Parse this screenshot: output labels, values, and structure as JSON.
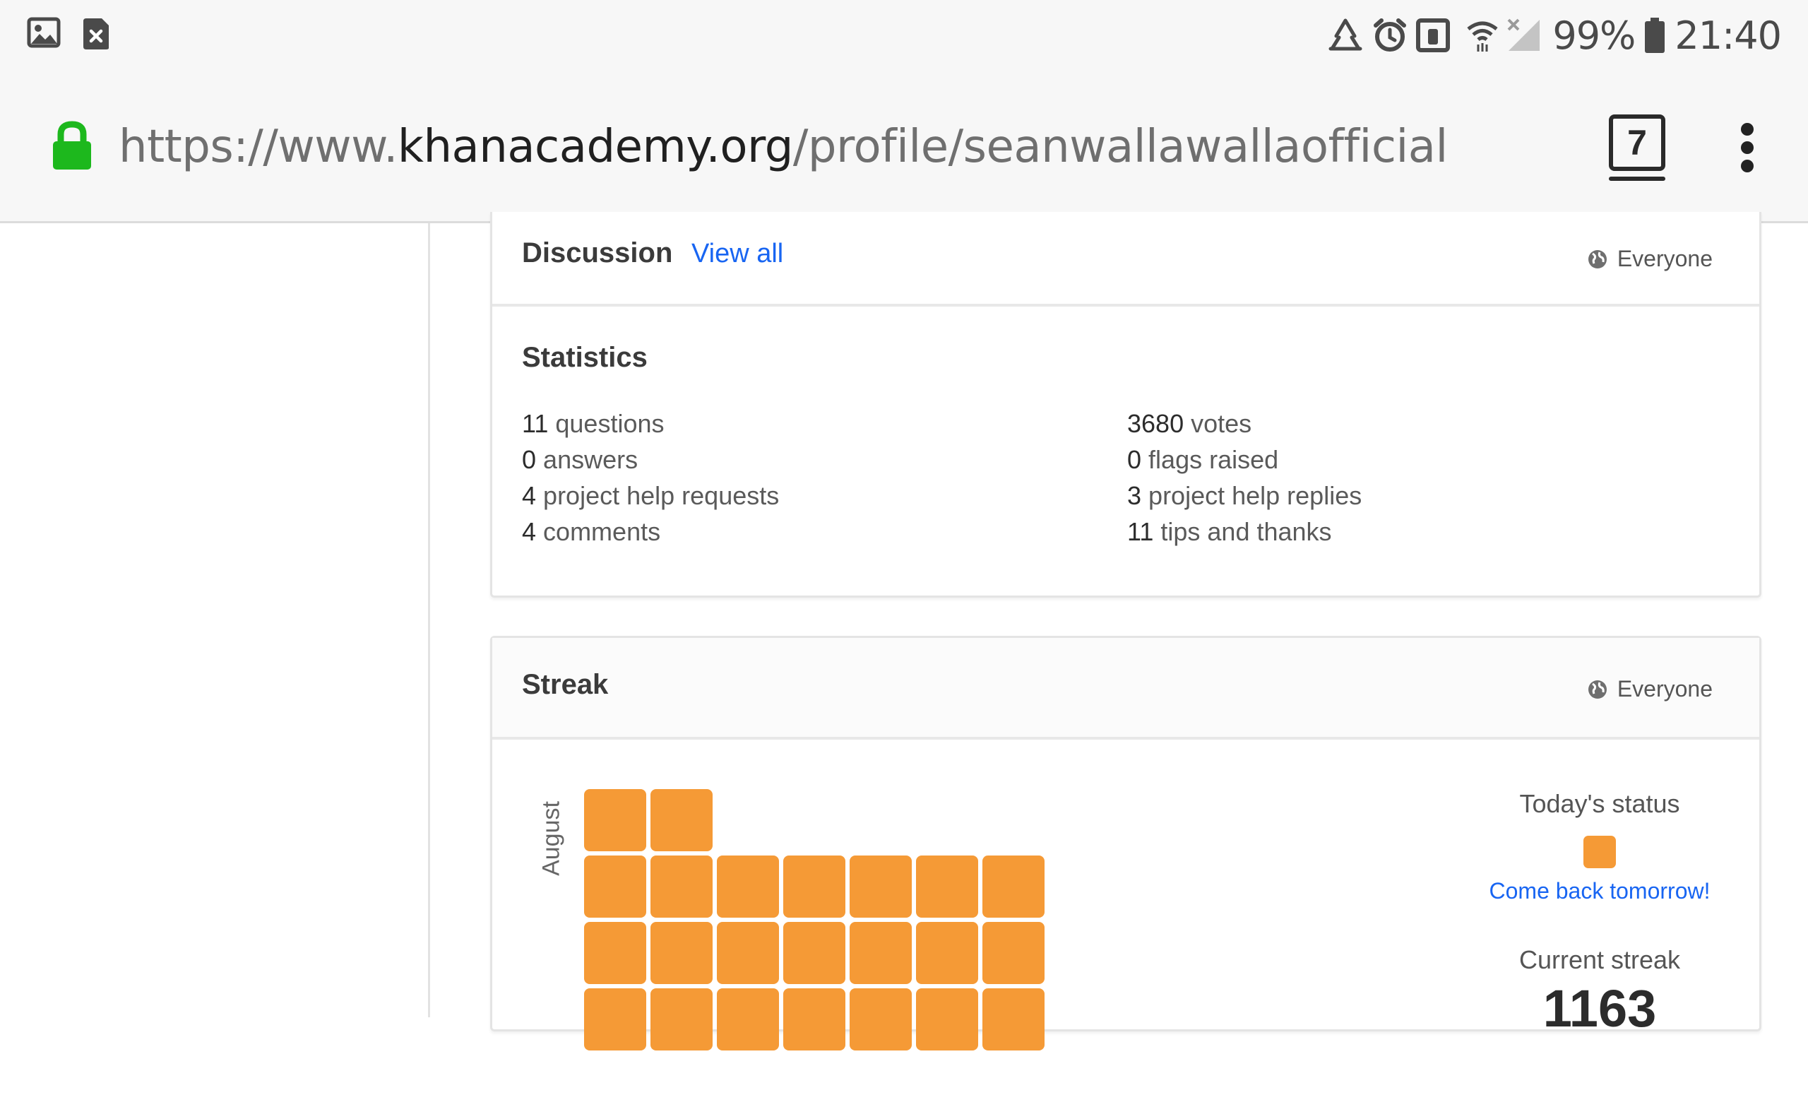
{
  "status_bar": {
    "battery": "99%",
    "time": "21:40"
  },
  "address_bar": {
    "url_prefix": "https://www.",
    "url_host": "khanacademy.org",
    "url_path": "/profile/seanwallawallaofficial",
    "tab_count": "7"
  },
  "discussion": {
    "title": "Discussion",
    "view_all": "View all",
    "privacy": "Everyone"
  },
  "statistics": {
    "title": "Statistics",
    "left": [
      {
        "num": "11",
        "label": "questions"
      },
      {
        "num": "0",
        "label": "answers"
      },
      {
        "num": "4",
        "label": "project help requests"
      },
      {
        "num": "4",
        "label": "comments"
      }
    ],
    "right": [
      {
        "num": "3680",
        "label": "votes"
      },
      {
        "num": "0",
        "label": "flags raised"
      },
      {
        "num": "3",
        "label": "project help replies"
      },
      {
        "num": "11",
        "label": "tips and thanks"
      }
    ]
  },
  "streak": {
    "title": "Streak",
    "privacy": "Everyone",
    "month": "August",
    "todays_status_label": "Today's status",
    "come_back": "Come back tomorrow!",
    "current_streak_label": "Current streak",
    "current_streak_value": "1163",
    "cell_color": "#f59a36"
  },
  "colors": {
    "link": "#1865f2",
    "lock": "#1db81d",
    "streak": "#f59a36"
  }
}
